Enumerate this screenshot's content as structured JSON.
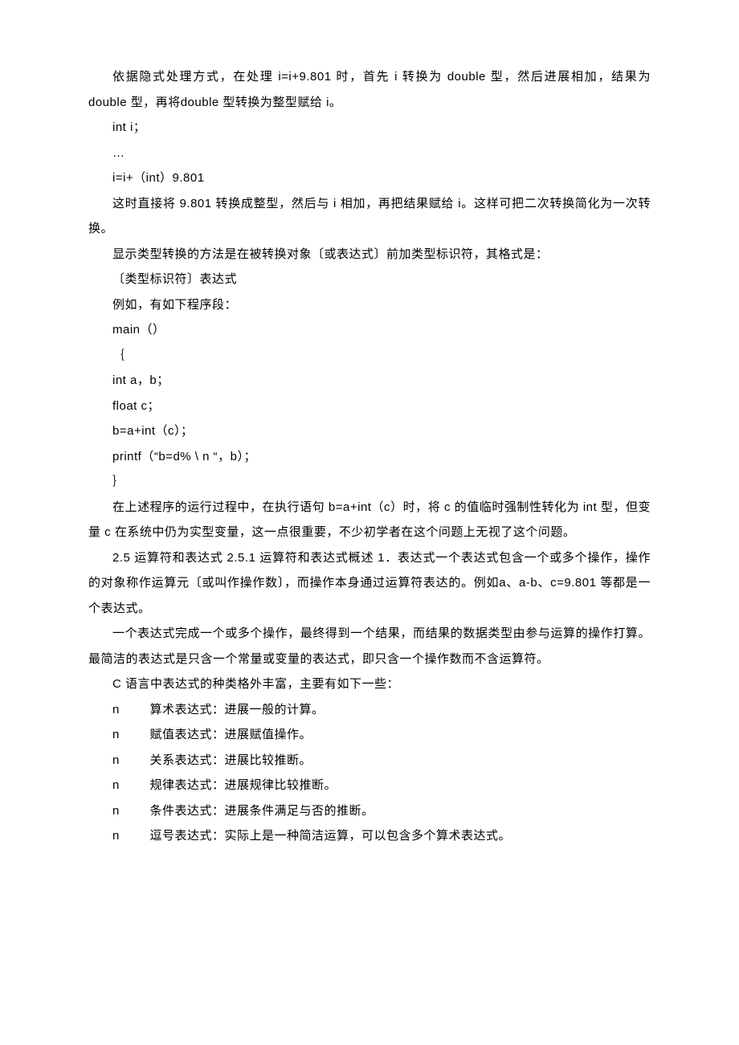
{
  "p1": "依据隐式处理方式，在处理 i=i+9.801 时，首先 i 转换为 double 型，然后进展相加，结果为 double 型，再将double 型转换为整型赋给 i。",
  "c1": "int i；",
  "c2": "…",
  "c3": "i=i+（int）9.801",
  "p2": "这时直接将 9.801 转换成整型，然后与 i 相加，再把结果赋给 i。这样可把二次转换简化为一次转换。",
  "p3": "显示类型转换的方法是在被转换对象〔或表达式〕前加类型标识符，其格式是：",
  "c4": "〔类型标识符〕表达式",
  "p4": "例如，有如下程序段：",
  "c5": "main（）",
  "c6": "｛",
  "c7": "int  a，b；",
  "c8": "float c；",
  "c9": "b=a+int（c）；",
  "c10": "printf（“b=d% \\ n “，b）；",
  "c11": "｝",
  "p5": "在上述程序的运行过程中，在执行语句 b=a+int（c）时，将 c 的值临时强制性转化为 int 型，但变量 c 在系统中仍为实型变量，这一点很重要，不少初学者在这个问题上无视了这个问题。",
  "p6": "2.5  运算符和表达式  2.5.1 运算符和表达式概述  1．表达式一个表达式包含一个或多个操作，操作的对象称作运算元〔或叫作操作数〕，而操作本身通过运算符表达的。例如a、a-b、c=9.801 等都是一个表达式。",
  "p7": "一个表达式完成一个或多个操作，最终得到一个结果，而结果的数据类型由参与运算的操作打算。最简洁的表达式是只含一个常量或变量的表达式，即只含一个操作数而不含运算符。",
  "p8": "C 语言中表达式的种类格外丰富，主要有如下一些：",
  "bullet": "n",
  "li1": "算术表达式：进展一般的计算。",
  "li2": "赋值表达式：进展赋值操作。",
  "li3": "关系表达式：进展比较推断。",
  "li4": "规律表达式：进展规律比较推断。",
  "li5": "条件表达式：进展条件满足与否的推断。",
  "li6": "逗号表达式：实际上是一种简洁运算，可以包含多个算术表达式。"
}
